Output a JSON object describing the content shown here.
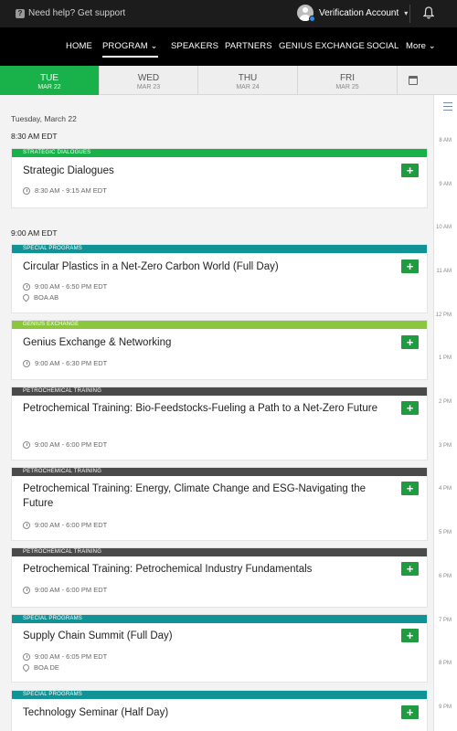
{
  "topbar": {
    "help": "Need help? Get support",
    "account": "Verification Account"
  },
  "nav": {
    "items": [
      "HOME",
      "PROGRAM",
      "SPEAKERS",
      "PARTNERS",
      "GENIUS EXCHANGE",
      "SOCIAL",
      "More"
    ]
  },
  "days": [
    {
      "day": "TUE",
      "date": "MAR 22",
      "active": true
    },
    {
      "day": "WED",
      "date": "MAR 23"
    },
    {
      "day": "THU",
      "date": "MAR 24"
    },
    {
      "day": "FRI",
      "date": "MAR 25"
    }
  ],
  "date_line": "Tuesday, March 22",
  "time_heads": [
    "8:30 AM EDT",
    "9:00 AM EDT"
  ],
  "hours": [
    "8 AM",
    "9 AM",
    "10 AM",
    "11 AM",
    "12 PM",
    "1 PM",
    "2 PM",
    "3 PM",
    "4 PM",
    "5 PM",
    "6 PM",
    "7 PM",
    "8 PM",
    "9 PM"
  ],
  "sessions": [
    {
      "category": "STRATEGIC DIALOGUES",
      "cat_color": "#19b14a",
      "title": "Strategic Dialogues",
      "time": "8:30 AM - 9:15 AM EDT"
    },
    {
      "category": "SPECIAL PROGRAMS",
      "cat_color": "#0f9396",
      "title": "Circular Plastics in a Net-Zero Carbon World (Full Day)",
      "time": "9:00 AM - 6:50 PM EDT",
      "location": "BOA AB"
    },
    {
      "category": "GENIUS EXCHANGE",
      "cat_color": "#8cc63f",
      "title": "Genius Exchange & Networking",
      "time": "9:00 AM - 6:30 PM EDT"
    },
    {
      "category": "PETROCHEMICAL TRAINING",
      "cat_color": "#4a4a4a",
      "title": "Petrochemical Training: Bio-Feedstocks-Fueling a Path to a Net-Zero Future",
      "time": "9:00 AM - 6:00 PM EDT"
    },
    {
      "category": "PETROCHEMICAL TRAINING",
      "cat_color": "#4a4a4a",
      "title": "Petrochemical Training: Energy, Climate Change and ESG-Navigating the Future",
      "time": "9:00 AM - 6:00 PM EDT"
    },
    {
      "category": "PETROCHEMICAL TRAINING",
      "cat_color": "#4a4a4a",
      "title": "Petrochemical Training: Petrochemical Industry Fundamentals",
      "time": "9:00 AM - 6:00 PM EDT"
    },
    {
      "category": "SPECIAL PROGRAMS",
      "cat_color": "#0f9396",
      "title": "Supply Chain Summit (Full Day)",
      "time": "9:00 AM - 6:05 PM EDT",
      "location": "BOA DE"
    },
    {
      "category": "SPECIAL PROGRAMS",
      "cat_color": "#0f9396",
      "title": "Technology Seminar (Half Day)"
    }
  ],
  "add_label": "+"
}
